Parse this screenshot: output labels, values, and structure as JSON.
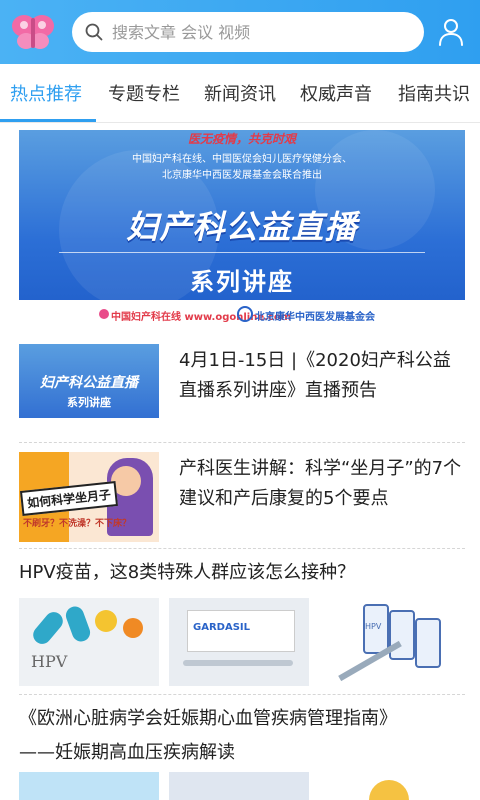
{
  "header": {
    "logo_icon": "butterfly-logo-icon",
    "search": {
      "placeholder": "搜索文章 会议 视频",
      "value": ""
    },
    "user_icon": "user-icon"
  },
  "tabs": [
    {
      "label": "热点推荐",
      "active": true
    },
    {
      "label": "专题专栏"
    },
    {
      "label": "新闻资讯"
    },
    {
      "label": "权威声音"
    },
    {
      "label": "指南共识"
    }
  ],
  "banner": {
    "slogan": "医无疫情，共克时艰",
    "sub_line1": "中国妇产科在线、中国医促会妇儿医疗保健分会、",
    "sub_line2": "北京康华中西医发展基金会联合推出",
    "title": "妇产科公益直播",
    "series": "系列讲座",
    "footer_left": "中国妇产科在线 www.ogonline.com",
    "footer_right": "北京康华中西医发展基金会"
  },
  "articles": [
    {
      "title": "4月1日-15日 |《2020妇产科公益直播系列讲座》直播预告",
      "thumb_title": "妇产科公益直播",
      "thumb_sub": "系列讲座"
    },
    {
      "title": "产科医生讲解：科学“坐月子”的7个建议和产后康复的5个要点",
      "thumb_title": "如何科学坐月子",
      "thumb_sub": "不刷牙？不洗澡？不下床？"
    }
  ],
  "hpv_article": {
    "title": "HPV疫苗，这8类特殊人群应该怎么接种？",
    "img_labels": [
      "HPV",
      "GARDASIL",
      "HPV"
    ]
  },
  "guide_article": {
    "title_line1": "《欧洲心脏病学会妊娠期心血管疾病管理指南》",
    "title_line2": "——妊娠期高血压疾病解读"
  },
  "colors": {
    "accent": "#2f9ff0",
    "header": "#3aa7f2",
    "banner_blue": "#2c6fd6",
    "slogan_red": "#e23b4a"
  }
}
